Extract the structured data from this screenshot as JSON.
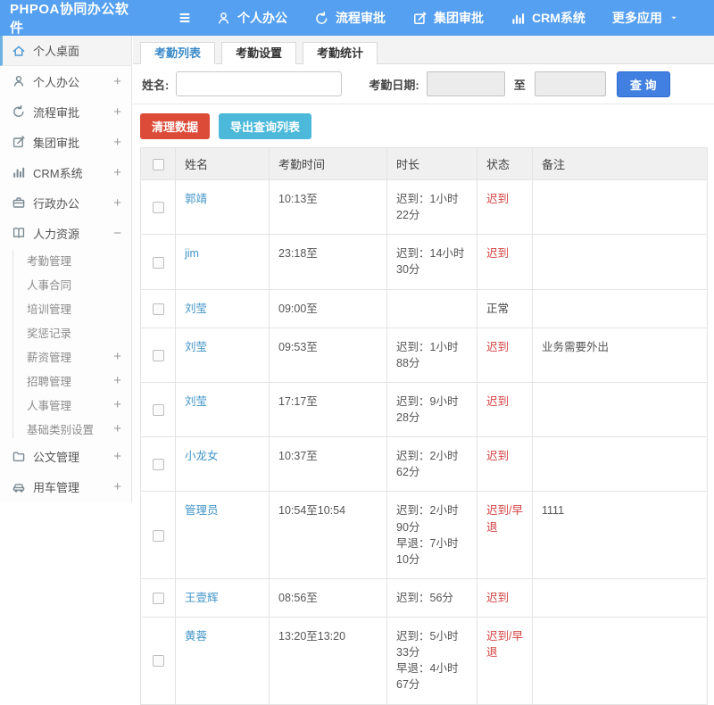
{
  "navbar": {
    "brand": "PHPOA协同办公软件",
    "items": [
      {
        "icon": "person-icon",
        "label": "个人办公"
      },
      {
        "icon": "process-icon",
        "label": "流程审批"
      },
      {
        "icon": "edit-icon",
        "label": "集团审批"
      },
      {
        "icon": "chart-icon",
        "label": "CRM系统"
      },
      {
        "icon": "",
        "label": "更多应用",
        "caret": true
      }
    ]
  },
  "sidebar": {
    "items": [
      {
        "icon": "home-icon",
        "label": "个人桌面",
        "active": true
      },
      {
        "icon": "person-icon",
        "label": "个人办公",
        "expand": "+"
      },
      {
        "icon": "process-icon",
        "label": "流程审批",
        "expand": "+"
      },
      {
        "icon": "edit-icon",
        "label": "集团审批",
        "expand": "+"
      },
      {
        "icon": "chart-icon",
        "label": "CRM系统",
        "expand": "+"
      },
      {
        "icon": "briefcase-icon",
        "label": "行政办公",
        "expand": "+"
      },
      {
        "icon": "book-icon",
        "label": "人力资源",
        "expand": "−",
        "children": [
          {
            "label": "考勤管理"
          },
          {
            "label": "人事合同"
          },
          {
            "label": "培训管理"
          },
          {
            "label": "奖惩记录"
          },
          {
            "label": "薪资管理",
            "expand": "+"
          },
          {
            "label": "招聘管理",
            "expand": "+"
          },
          {
            "label": "人事管理",
            "expand": "+"
          },
          {
            "label": "基础类别设置",
            "expand": "+"
          }
        ]
      },
      {
        "icon": "folder-icon",
        "label": "公文管理",
        "expand": "+"
      },
      {
        "icon": "car-icon",
        "label": "用车管理",
        "expand": "+"
      }
    ]
  },
  "main": {
    "tabs": [
      {
        "label": "考勤列表",
        "active": true
      },
      {
        "label": "考勤设置",
        "active": false
      },
      {
        "label": "考勤统计",
        "active": false
      }
    ],
    "filter": {
      "name_label": "姓名:",
      "name_value": "",
      "date_label": "考勤日期:",
      "date_from_value": "",
      "to_label": "至",
      "date_to_value": "",
      "search_button": "查 询"
    },
    "actions": {
      "clean_button": "清理数据",
      "export_button": "导出查询列表"
    },
    "table": {
      "headers": [
        "姓名",
        "考勤时间",
        "时长",
        "状态",
        "备注"
      ],
      "rows": [
        {
          "name": "郭靖",
          "time": "10:13至",
          "duration": [
            "迟到：1小时22分"
          ],
          "status": "迟到",
          "status_red": true,
          "note": ""
        },
        {
          "name": "jim",
          "time": "23:18至",
          "duration": [
            "迟到：14小时30分"
          ],
          "status": "迟到",
          "status_red": true,
          "note": ""
        },
        {
          "name": "刘莹",
          "time": "09:00至",
          "duration": [],
          "status": "正常",
          "status_red": false,
          "note": ""
        },
        {
          "name": "刘莹",
          "time": "09:53至",
          "duration": [
            "迟到：1小时88分"
          ],
          "status": "迟到",
          "status_red": true,
          "note": "业务需要外出"
        },
        {
          "name": "刘莹",
          "time": "17:17至",
          "duration": [
            "迟到：9小时28分"
          ],
          "status": "迟到",
          "status_red": true,
          "note": ""
        },
        {
          "name": "小龙女",
          "time": "10:37至",
          "duration": [
            "迟到：2小时62分"
          ],
          "status": "迟到",
          "status_red": true,
          "note": ""
        },
        {
          "name": "管理员",
          "time": "10:54至10:54",
          "duration": [
            "迟到：2小时90分",
            "早退：7小时10分"
          ],
          "status": "迟到/早退",
          "status_red": true,
          "note": "1111"
        },
        {
          "name": "王壹辉",
          "time": "08:56至",
          "duration": [
            "迟到：56分"
          ],
          "status": "迟到",
          "status_red": true,
          "note": ""
        },
        {
          "name": "黄蓉",
          "time": "13:20至13:20",
          "duration": [
            "迟到：5小时33分",
            "早退：4小时67分"
          ],
          "status": "迟到/早退",
          "status_red": true,
          "note": ""
        }
      ]
    }
  },
  "colors": {
    "navbar_bg": "#55a0f0",
    "link_blue": "#4094c8",
    "status_red": "#d43f3f",
    "danger_button": "#dc4a38",
    "info_button": "#4cb9db",
    "search_button": "#417fe0",
    "active_tab_text": "#3a8ac8"
  }
}
